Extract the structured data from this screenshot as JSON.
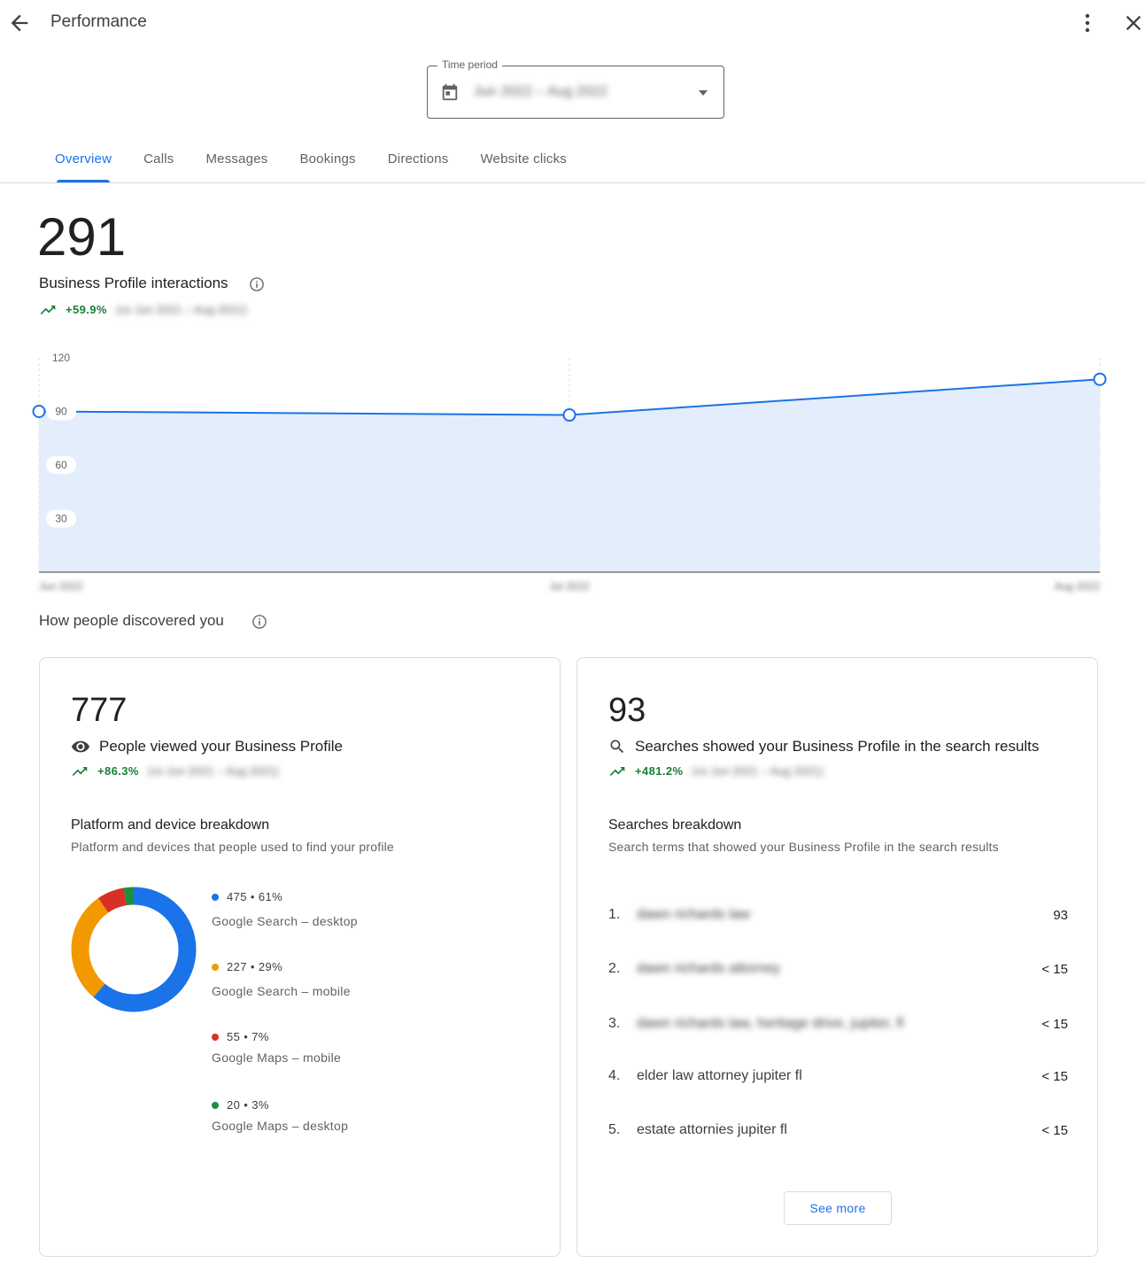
{
  "header": {
    "title": "Performance"
  },
  "time_period": {
    "label": "Time period",
    "value": "Jun 2022 – Aug 2022"
  },
  "tabs": [
    {
      "label": "Overview",
      "active": true
    },
    {
      "label": "Calls"
    },
    {
      "label": "Messages"
    },
    {
      "label": "Bookings"
    },
    {
      "label": "Directions"
    },
    {
      "label": "Website clicks"
    }
  ],
  "summary": {
    "total": "291",
    "label": "Business Profile interactions",
    "trend": "+59.9%",
    "comparison": "(vs Jun 2021 – Aug 2021)"
  },
  "chart_data": {
    "type": "area",
    "x": [
      "Jun 2022",
      "Jul 2022",
      "Aug 2022"
    ],
    "values": [
      90,
      88,
      108
    ],
    "ylim": [
      0,
      120
    ],
    "yticks": [
      30,
      60,
      90,
      120
    ],
    "color": "#1a73e8",
    "fill": "#e4edfc"
  },
  "discovery": {
    "title": "How people discovered you",
    "views": {
      "total": "777",
      "label": "People viewed your Business Profile",
      "trend": "+86.3%",
      "comparison": "(vs Jun 2021 – Aug 2021)",
      "breakdown_title": "Platform and device breakdown",
      "breakdown_desc": "Platform and devices that people used to find your profile",
      "segments": [
        {
          "count": "475",
          "pct": "61%",
          "value": 475,
          "label": "Google Search – desktop",
          "color": "#1a73e8"
        },
        {
          "count": "227",
          "pct": "29%",
          "value": 227,
          "label": "Google Search – mobile",
          "color": "#f29900"
        },
        {
          "count": "55",
          "pct": "7%",
          "value": 55,
          "label": "Google Maps – mobile",
          "color": "#d93025"
        },
        {
          "count": "20",
          "pct": "3%",
          "value": 20,
          "label": "Google Maps – desktop",
          "color": "#1e8e3e"
        }
      ]
    },
    "searches": {
      "total": "93",
      "label": "Searches showed your Business Profile in the search results",
      "trend": "+481.2%",
      "comparison": "(vs Jun 2021 – Aug 2021)",
      "breakdown_title": "Searches breakdown",
      "breakdown_desc": "Search terms that showed your Business Profile in the search results",
      "terms": [
        {
          "index": "1.",
          "term": "dawn richards law",
          "count": "93"
        },
        {
          "index": "2.",
          "term": "dawn richards attorney",
          "count": "< 15"
        },
        {
          "index": "3.",
          "term": "dawn richards law, heritage drive, jupiter, fl",
          "count": "< 15"
        },
        {
          "index": "4.",
          "term": "elder law attorney jupiter fl",
          "count": "< 15"
        },
        {
          "index": "5.",
          "term": "estate attornies jupiter fl",
          "count": "< 15"
        }
      ],
      "see_more": "See more"
    }
  }
}
